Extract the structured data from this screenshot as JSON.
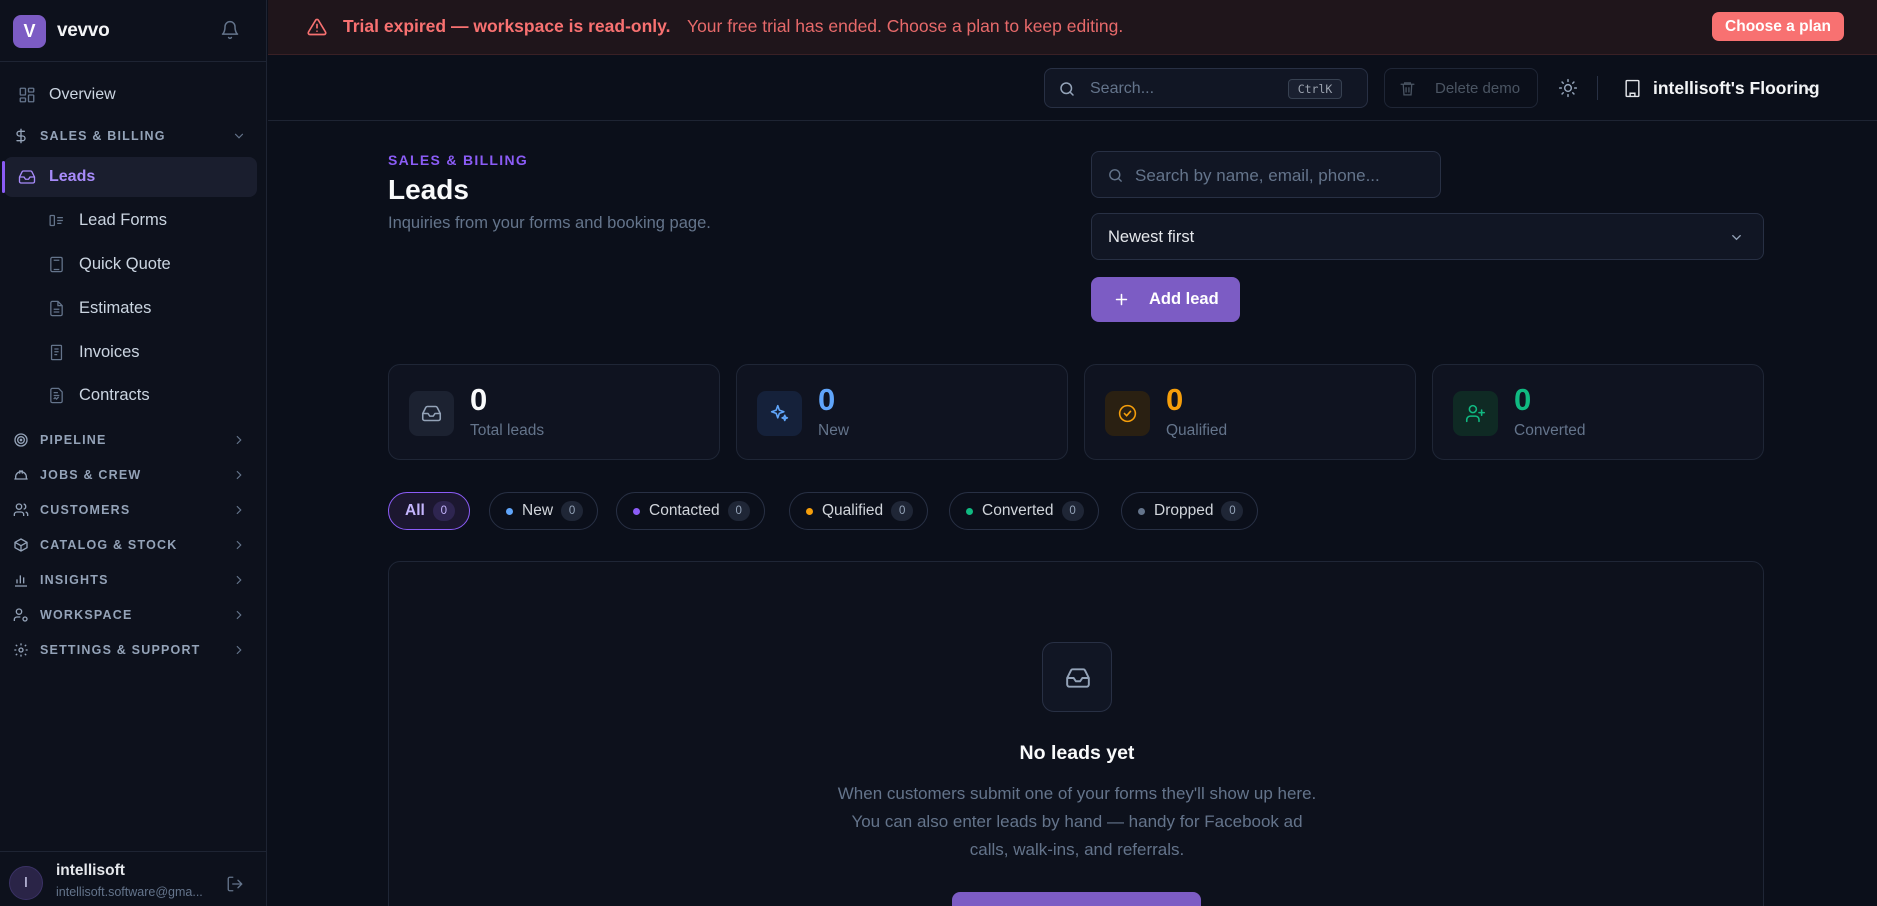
{
  "brand": {
    "logo_letter": "V",
    "name": "vevvo"
  },
  "sidebar": {
    "overview": "Overview",
    "sales_section": "SALES & BILLING",
    "active_item": "Leads",
    "sub_items": [
      "Lead Forms",
      "Quick Quote",
      "Estimates",
      "Invoices",
      "Contracts"
    ],
    "sections": [
      "PIPELINE",
      "JOBS & CREW",
      "CUSTOMERS",
      "CATALOG & STOCK",
      "INSIGHTS",
      "WORKSPACE",
      "SETTINGS & SUPPORT"
    ]
  },
  "user": {
    "initial": "I",
    "name": "intellisoft",
    "email": "intellisoft.software@gma..."
  },
  "banner": {
    "bold": "Trial expired — workspace is read-only.",
    "message": "Your free trial has ended. Choose a plan to keep editing.",
    "button": "Choose a plan"
  },
  "topbar": {
    "search_placeholder": "Search...",
    "shortcut": "CtrlK",
    "delete_demo": "Delete demo",
    "workspace": "intellisoft's Flooring"
  },
  "page": {
    "eyebrow": "SALES & BILLING",
    "title": "Leads",
    "subtitle": "Inquiries from your forms and booking page."
  },
  "controls": {
    "search_placeholder": "Search by name, email, phone...",
    "sort": "Newest first",
    "add_lead": "Add lead"
  },
  "stats": [
    {
      "value": "0",
      "label": "Total leads",
      "color": "#f9fafb"
    },
    {
      "value": "0",
      "label": "New",
      "color": "#60a5fa"
    },
    {
      "value": "0",
      "label": "Qualified",
      "color": "#f59e0b"
    },
    {
      "value": "0",
      "label": "Converted",
      "color": "#10b981"
    }
  ],
  "filters": [
    {
      "label": "All",
      "count": "0"
    },
    {
      "label": "New",
      "count": "0",
      "dot": "#60a5fa"
    },
    {
      "label": "Contacted",
      "count": "0",
      "dot": "#8b5cf6"
    },
    {
      "label": "Qualified",
      "count": "0",
      "dot": "#f59e0b"
    },
    {
      "label": "Converted",
      "count": "0",
      "dot": "#10b981"
    },
    {
      "label": "Dropped",
      "count": "0",
      "dot": "#64748b"
    }
  ],
  "empty": {
    "title": "No leads yet",
    "description": "When customers submit one of your forms they'll show up here. You can also enter leads by hand — handy for Facebook ad calls, walk-ins, and referrals."
  }
}
